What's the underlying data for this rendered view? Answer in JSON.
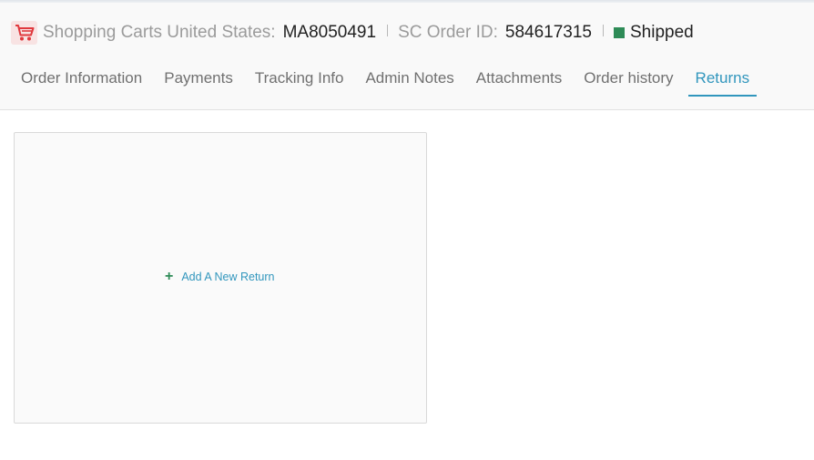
{
  "header": {
    "store_label": "Shopping Carts United States:",
    "store_value": "MA8050491",
    "order_label": "SC Order ID:",
    "order_value": "584617315",
    "status": "Shipped",
    "status_color": "#2e8b57",
    "icon": "shopping-cart-icon"
  },
  "tabs": [
    {
      "label": "Order Information"
    },
    {
      "label": "Payments"
    },
    {
      "label": "Tracking Info"
    },
    {
      "label": "Admin Notes"
    },
    {
      "label": "Attachments"
    },
    {
      "label": "Order history"
    },
    {
      "label": "Returns",
      "active": true
    }
  ],
  "returns": {
    "add_label": "Add A New Return",
    "add_icon": "plus-icon"
  },
  "colors": {
    "accent": "#3196bd",
    "cart_icon": "#e0393e"
  }
}
